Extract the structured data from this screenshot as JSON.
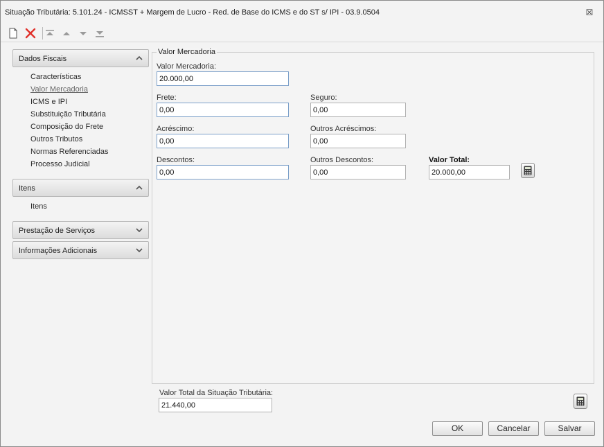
{
  "window": {
    "title": "Situação Tributária: 5.101.24 - ICMSST + Margem de Lucro - Red. de Base do ICMS e do ST s/ IPI - 03.9.0504",
    "close_glyph": "☒"
  },
  "toolbar": {
    "buttons": [
      "new-document-icon",
      "delete-icon",
      "move-first-icon",
      "move-up-icon",
      "move-down-icon",
      "move-last-icon"
    ]
  },
  "sidebar": {
    "sections": [
      {
        "title": "Dados Fiscais",
        "expanded": true,
        "items": [
          {
            "label": "Características"
          },
          {
            "label": "Valor Mercadoria",
            "active": true
          },
          {
            "label": "ICMS e IPI"
          },
          {
            "label": "Substituição Tributária"
          },
          {
            "label": "Composição do Frete"
          },
          {
            "label": "Outros Tributos"
          },
          {
            "label": "Normas Referenciadas"
          },
          {
            "label": "Processo Judicial"
          }
        ]
      },
      {
        "title": "Itens",
        "expanded": true,
        "items": [
          {
            "label": "Itens"
          }
        ]
      },
      {
        "title": "Prestação de Serviços",
        "expanded": false,
        "items": []
      },
      {
        "title": "Informações Adicionais",
        "expanded": false,
        "items": []
      }
    ]
  },
  "form": {
    "group_title": "Valor Mercadoria",
    "valor_mercadoria": {
      "label": "Valor Mercadoria:",
      "value": "20.000,00"
    },
    "frete": {
      "label": "Frete:",
      "value": "0,00"
    },
    "seguro": {
      "label": "Seguro:",
      "value": "0,00"
    },
    "acrescimo": {
      "label": "Acréscimo:",
      "value": "0,00"
    },
    "outros_acrescimos": {
      "label": "Outros Acréscimos:",
      "value": "0,00"
    },
    "descontos": {
      "label": "Descontos:",
      "value": "0,00"
    },
    "outros_descontos": {
      "label": "Outros Descontos:",
      "value": "0,00"
    },
    "valor_total": {
      "label": "Valor Total:",
      "value": "20.000,00"
    }
  },
  "footer": {
    "total_label": "Valor Total da Situação Tributária:",
    "total_value": "21.440,00",
    "ok_label": "OK",
    "cancel_label": "Cancelar",
    "save_label": "Salvar"
  },
  "colors": {
    "delete_icon": "#e0302a",
    "accent_border": "#7b9fc9"
  }
}
